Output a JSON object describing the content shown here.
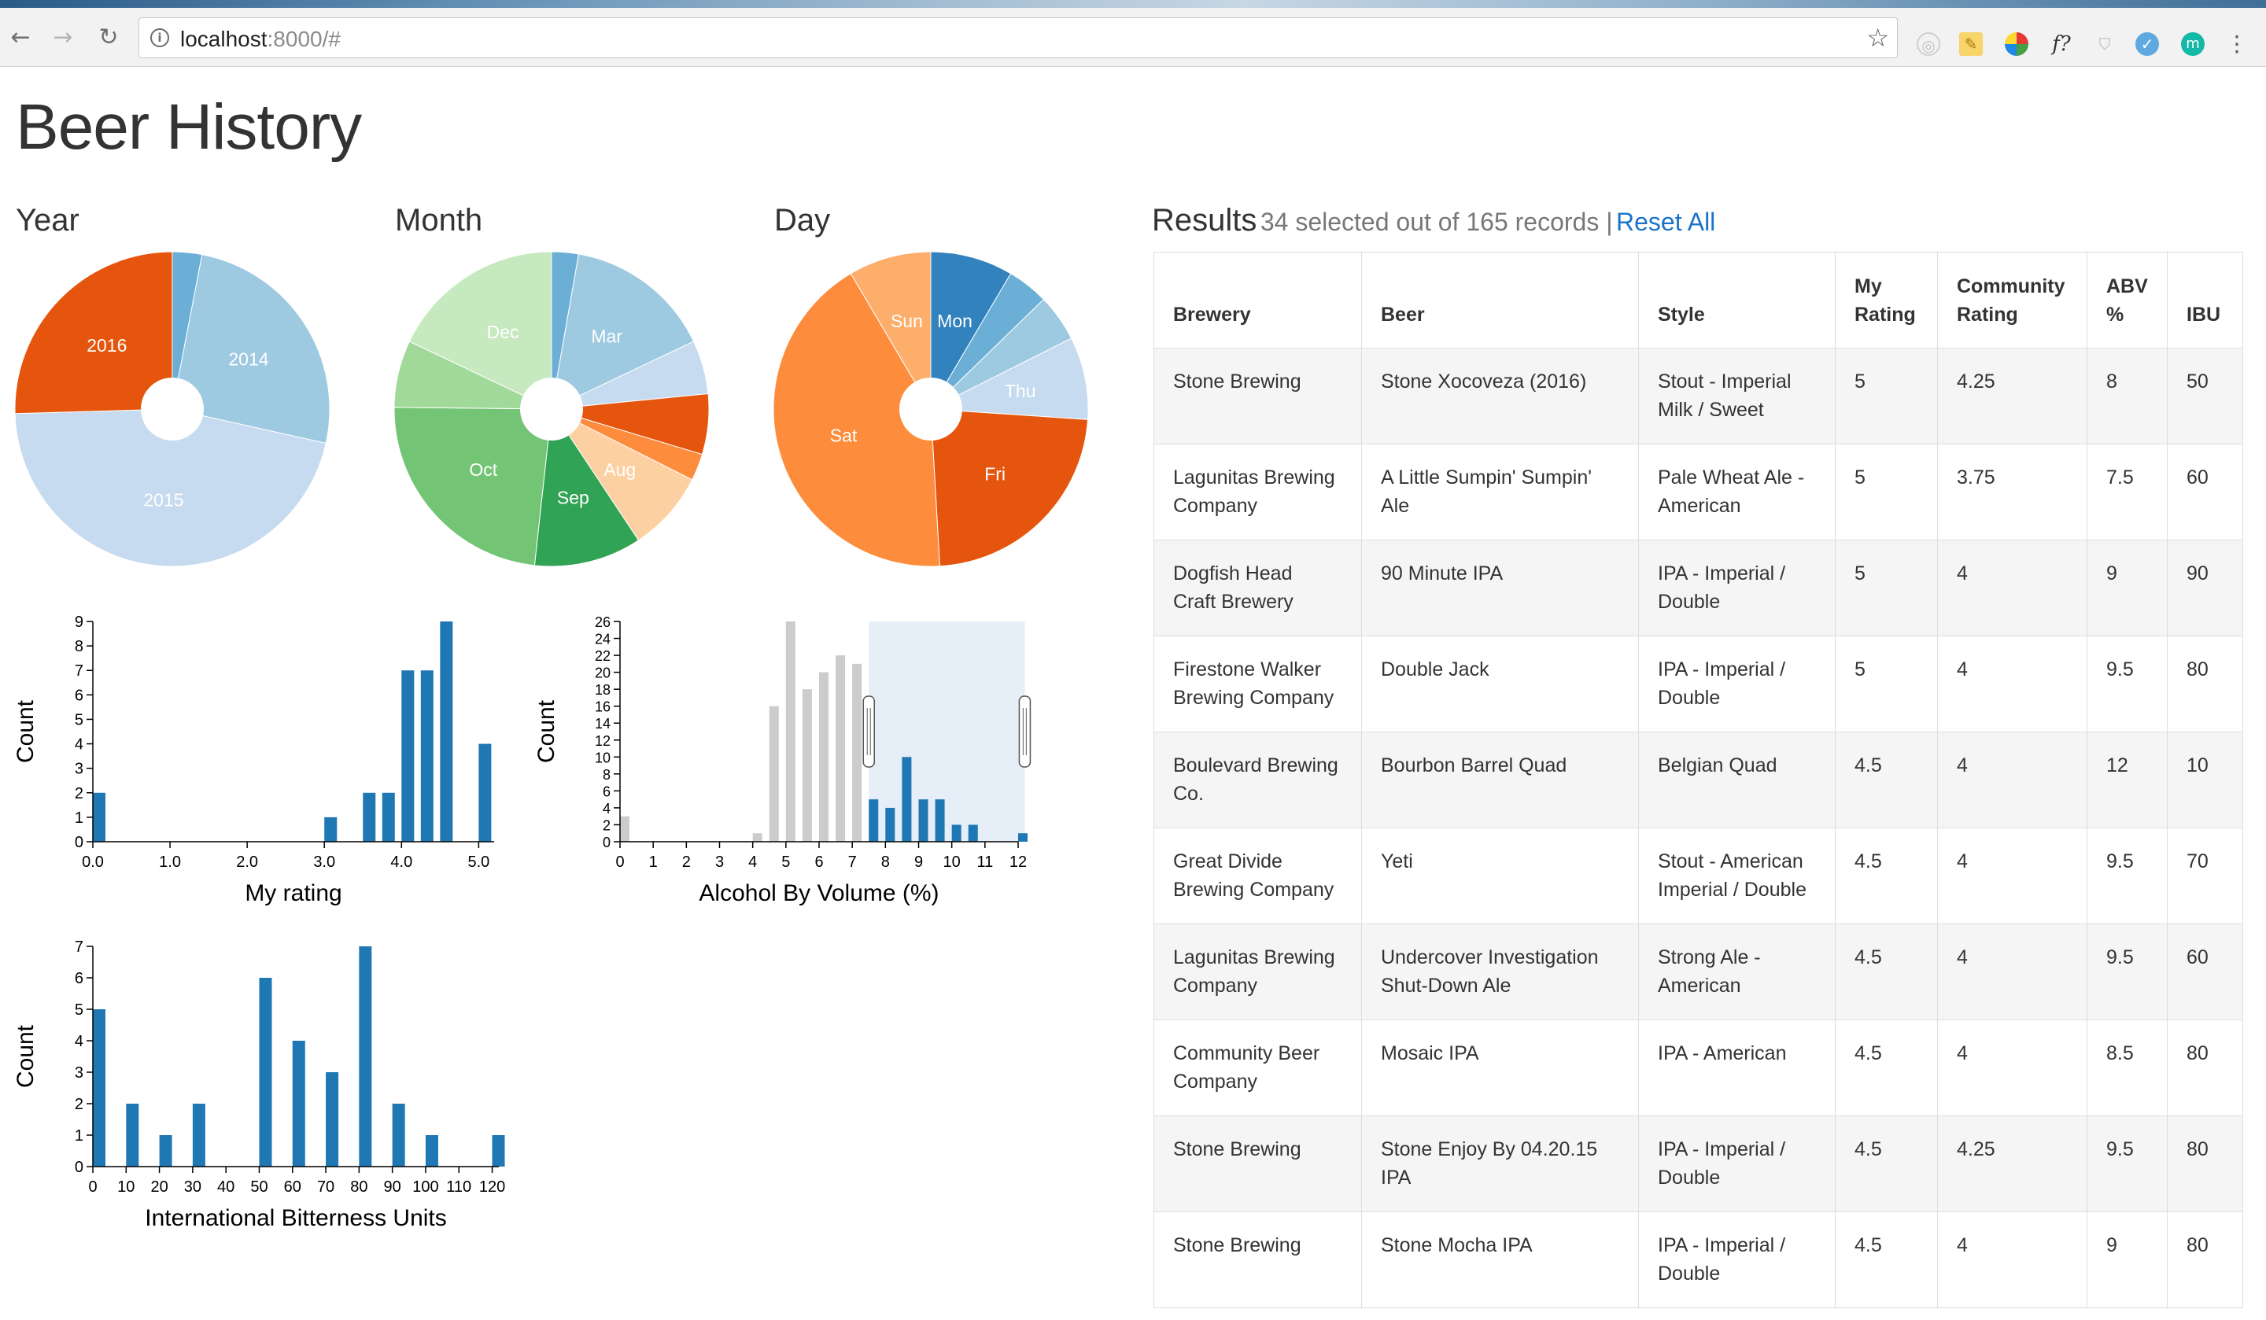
{
  "browser": {
    "url_host": "localhost",
    "url_rest": ":8000/#"
  },
  "page": {
    "title": "Beer History"
  },
  "pies": {
    "year": {
      "title": "Year",
      "slices": [
        {
          "label": "",
          "value": 5,
          "color": "#6baed6"
        },
        {
          "label": "2014",
          "value": 42,
          "color": "#9ecae1"
        },
        {
          "label": "2015",
          "value": 76,
          "color": "#c6dbef"
        },
        {
          "label": "2016",
          "value": 42,
          "color": "#e6550d"
        }
      ]
    },
    "month": {
      "title": "Month",
      "slices": [
        {
          "label": "",
          "value": 4,
          "color": "#6baed6"
        },
        {
          "label": "Mar",
          "value": 22,
          "color": "#9ecae1"
        },
        {
          "label": "",
          "value": 8,
          "color": "#c6dbef"
        },
        {
          "label": "",
          "value": 9,
          "color": "#e6550d"
        },
        {
          "label": "",
          "value": 4,
          "color": "#fd8d3c"
        },
        {
          "label": "Aug",
          "value": 12,
          "color": "#fdd0a2"
        },
        {
          "label": "Sep",
          "value": 16,
          "color": "#31a354"
        },
        {
          "label": "Oct",
          "value": 34,
          "color": "#74c476"
        },
        {
          "label": "",
          "value": 10,
          "color": "#a1d99b"
        },
        {
          "label": "Dec",
          "value": 26,
          "color": "#c7e9c0"
        }
      ]
    },
    "day": {
      "title": "Day",
      "slices": [
        {
          "label": "Mon",
          "value": 14,
          "color": "#3182bd"
        },
        {
          "label": "",
          "value": 7,
          "color": "#6baed6"
        },
        {
          "label": "",
          "value": 8,
          "color": "#9ecae1"
        },
        {
          "label": "Thu",
          "value": 14,
          "color": "#c6dbef"
        },
        {
          "label": "Fri",
          "value": 38,
          "color": "#e6550d"
        },
        {
          "label": "Sat",
          "value": 70,
          "color": "#fd8d3c"
        },
        {
          "label": "Sun",
          "value": 14,
          "color": "#fdae6b"
        }
      ]
    }
  },
  "histograms": {
    "rating": {
      "xlabel": "My rating",
      "ylabel": "Count",
      "ylim": [
        0,
        9
      ],
      "yticks": [
        "0",
        "1",
        "2",
        "3",
        "4",
        "5",
        "6",
        "7",
        "8",
        "9"
      ],
      "xlim": [
        0,
        5.2
      ],
      "xticks": [
        {
          "v": 0,
          "t": "0.0"
        },
        {
          "v": 1,
          "t": "1.0"
        },
        {
          "v": 2,
          "t": "2.0"
        },
        {
          "v": 3,
          "t": "3.0"
        },
        {
          "v": 4,
          "t": "4.0"
        },
        {
          "v": 5,
          "t": "5.0"
        }
      ],
      "bars": [
        {
          "x": 0.0,
          "y": 2
        },
        {
          "x": 3.0,
          "y": 1
        },
        {
          "x": 3.5,
          "y": 2
        },
        {
          "x": 3.75,
          "y": 2
        },
        {
          "x": 4.0,
          "y": 7
        },
        {
          "x": 4.25,
          "y": 7
        },
        {
          "x": 4.5,
          "y": 9
        },
        {
          "x": 5.0,
          "y": 4
        }
      ]
    },
    "abv": {
      "xlabel": "Alcohol By Volume (%)",
      "ylabel": "Count",
      "ylim": [
        0,
        26
      ],
      "yticks": [
        "0",
        "2",
        "4",
        "6",
        "8",
        "10",
        "12",
        "14",
        "16",
        "18",
        "20",
        "22",
        "24",
        "26"
      ],
      "xlim": [
        0,
        12
      ],
      "xticks": [
        {
          "v": 0,
          "t": "0"
        },
        {
          "v": 1,
          "t": "1"
        },
        {
          "v": 2,
          "t": "2"
        },
        {
          "v": 3,
          "t": "3"
        },
        {
          "v": 4,
          "t": "4"
        },
        {
          "v": 5,
          "t": "5"
        },
        {
          "v": 6,
          "t": "6"
        },
        {
          "v": 7,
          "t": "7"
        },
        {
          "v": 8,
          "t": "8"
        },
        {
          "v": 9,
          "t": "9"
        },
        {
          "v": 10,
          "t": "10"
        },
        {
          "v": 11,
          "t": "11"
        },
        {
          "v": 12,
          "t": "12"
        }
      ],
      "brush": [
        7.5,
        12.2
      ],
      "bars": [
        {
          "x": 0.0,
          "y": 3,
          "sel": false
        },
        {
          "x": 4.0,
          "y": 1,
          "sel": false
        },
        {
          "x": 4.5,
          "y": 16,
          "sel": false
        },
        {
          "x": 5.0,
          "y": 26,
          "sel": false
        },
        {
          "x": 5.5,
          "y": 18,
          "sel": false
        },
        {
          "x": 6.0,
          "y": 20,
          "sel": false
        },
        {
          "x": 6.5,
          "y": 22,
          "sel": false
        },
        {
          "x": 7.0,
          "y": 21,
          "sel": false
        },
        {
          "x": 7.5,
          "y": 5,
          "sel": true
        },
        {
          "x": 8.0,
          "y": 4,
          "sel": true
        },
        {
          "x": 8.5,
          "y": 10,
          "sel": true
        },
        {
          "x": 9.0,
          "y": 5,
          "sel": true
        },
        {
          "x": 9.5,
          "y": 5,
          "sel": true
        },
        {
          "x": 10.0,
          "y": 2,
          "sel": true
        },
        {
          "x": 10.5,
          "y": 2,
          "sel": true
        },
        {
          "x": 12.0,
          "y": 1,
          "sel": true
        }
      ]
    },
    "ibu": {
      "xlabel": "International Bitterness Units",
      "ylabel": "Count",
      "ylim": [
        0,
        7
      ],
      "yticks": [
        "0",
        "1",
        "2",
        "3",
        "4",
        "5",
        "6",
        "7"
      ],
      "xlim": [
        0,
        122
      ],
      "xticks": [
        {
          "v": 0,
          "t": "0"
        },
        {
          "v": 10,
          "t": "10"
        },
        {
          "v": 20,
          "t": "20"
        },
        {
          "v": 30,
          "t": "30"
        },
        {
          "v": 40,
          "t": "40"
        },
        {
          "v": 50,
          "t": "50"
        },
        {
          "v": 60,
          "t": "60"
        },
        {
          "v": 70,
          "t": "70"
        },
        {
          "v": 80,
          "t": "80"
        },
        {
          "v": 90,
          "t": "90"
        },
        {
          "v": 100,
          "t": "100"
        },
        {
          "v": 110,
          "t": "110"
        },
        {
          "v": 120,
          "t": "120"
        }
      ],
      "bars": [
        {
          "x": 0,
          "y": 5
        },
        {
          "x": 10,
          "y": 2
        },
        {
          "x": 20,
          "y": 1
        },
        {
          "x": 30,
          "y": 2
        },
        {
          "x": 50,
          "y": 6
        },
        {
          "x": 60,
          "y": 4
        },
        {
          "x": 70,
          "y": 3
        },
        {
          "x": 80,
          "y": 7
        },
        {
          "x": 90,
          "y": 2
        },
        {
          "x": 100,
          "y": 1
        },
        {
          "x": 120,
          "y": 1
        }
      ]
    }
  },
  "results": {
    "title": "Results",
    "summary": "34 selected out of 165 records |",
    "reset_label": "Reset All",
    "columns": [
      {
        "l1": "Brewery",
        "l2": ""
      },
      {
        "l1": "Beer",
        "l2": ""
      },
      {
        "l1": "Style",
        "l2": ""
      },
      {
        "l1": "My",
        "l2": "Rating"
      },
      {
        "l1": "Community",
        "l2": "Rating"
      },
      {
        "l1": "ABV",
        "l2": "%"
      },
      {
        "l1": "IBU",
        "l2": ""
      }
    ],
    "rows": [
      {
        "brewery": [
          "Stone Brewing",
          ""
        ],
        "beer": [
          "Stone Xocoveza (2016)",
          ""
        ],
        "style": [
          "Stout - Imperial",
          "Milk / Sweet"
        ],
        "my": "5",
        "community": "4.25",
        "abv": "8",
        "ibu": "50"
      },
      {
        "brewery": [
          "Lagunitas Brewing",
          "Company"
        ],
        "beer": [
          "A Little Sumpin' Sumpin'",
          "Ale"
        ],
        "style": [
          "Pale Wheat Ale -",
          "American"
        ],
        "my": "5",
        "community": "3.75",
        "abv": "7.5",
        "ibu": "60"
      },
      {
        "brewery": [
          "Dogfish Head",
          "Craft Brewery"
        ],
        "beer": [
          "90 Minute IPA",
          ""
        ],
        "style": [
          "IPA - Imperial /",
          "Double"
        ],
        "my": "5",
        "community": "4",
        "abv": "9",
        "ibu": "90"
      },
      {
        "brewery": [
          "Firestone Walker",
          "Brewing Company"
        ],
        "beer": [
          "Double Jack",
          ""
        ],
        "style": [
          "IPA - Imperial /",
          "Double"
        ],
        "my": "5",
        "community": "4",
        "abv": "9.5",
        "ibu": "80"
      },
      {
        "brewery": [
          "Boulevard Brewing",
          "Co."
        ],
        "beer": [
          "Bourbon Barrel Quad",
          ""
        ],
        "style": [
          "Belgian Quad",
          ""
        ],
        "my": "4.5",
        "community": "4",
        "abv": "12",
        "ibu": "10"
      },
      {
        "brewery": [
          "Great Divide",
          "Brewing Company"
        ],
        "beer": [
          "Yeti",
          ""
        ],
        "style": [
          "Stout - American",
          "Imperial / Double"
        ],
        "my": "4.5",
        "community": "4",
        "abv": "9.5",
        "ibu": "70"
      },
      {
        "brewery": [
          "Lagunitas Brewing",
          "Company"
        ],
        "beer": [
          "Undercover Investigation",
          "Shut-Down Ale"
        ],
        "style": [
          "Strong Ale -",
          "American"
        ],
        "my": "4.5",
        "community": "4",
        "abv": "9.5",
        "ibu": "60"
      },
      {
        "brewery": [
          "Community Beer",
          "Company"
        ],
        "beer": [
          "Mosaic IPA",
          ""
        ],
        "style": [
          "IPA - American",
          ""
        ],
        "my": "4.5",
        "community": "4",
        "abv": "8.5",
        "ibu": "80"
      },
      {
        "brewery": [
          "Stone Brewing",
          ""
        ],
        "beer": [
          "Stone Enjoy By 04.20.15",
          "IPA"
        ],
        "style": [
          "IPA - Imperial /",
          "Double"
        ],
        "my": "4.5",
        "community": "4.25",
        "abv": "9.5",
        "ibu": "80"
      },
      {
        "brewery": [
          "Stone Brewing",
          ""
        ],
        "beer": [
          "Stone Mocha IPA",
          ""
        ],
        "style": [
          "IPA - Imperial /",
          "Double"
        ],
        "my": "4.5",
        "community": "4",
        "abv": "9",
        "ibu": "80"
      }
    ]
  },
  "chart_data": [
    {
      "type": "pie",
      "title": "Year",
      "categories": [
        "",
        "2014",
        "2015",
        "2016"
      ],
      "values": [
        5,
        42,
        76,
        42
      ]
    },
    {
      "type": "pie",
      "title": "Month",
      "categories": [
        "",
        "Mar",
        "",
        "",
        "",
        "Aug",
        "Sep",
        "Oct",
        "",
        "Dec"
      ],
      "values": [
        4,
        22,
        8,
        9,
        4,
        12,
        16,
        34,
        10,
        26
      ]
    },
    {
      "type": "pie",
      "title": "Day",
      "categories": [
        "Mon",
        "",
        "",
        "Thu",
        "Fri",
        "Sat",
        "Sun"
      ],
      "values": [
        14,
        7,
        8,
        14,
        38,
        70,
        14
      ]
    },
    {
      "type": "bar",
      "xlabel": "My rating",
      "ylabel": "Count",
      "x": [
        0.0,
        3.0,
        3.5,
        3.75,
        4.0,
        4.25,
        4.5,
        5.0
      ],
      "values": [
        2,
        1,
        2,
        2,
        7,
        7,
        9,
        4
      ],
      "ylim": [
        0,
        9
      ]
    },
    {
      "type": "bar",
      "xlabel": "Alcohol By Volume (%)",
      "ylabel": "Count",
      "x": [
        0,
        4,
        4.5,
        5,
        5.5,
        6,
        6.5,
        7,
        7.5,
        8,
        8.5,
        9,
        9.5,
        10,
        10.5,
        12
      ],
      "values": [
        3,
        1,
        16,
        26,
        18,
        20,
        22,
        21,
        5,
        4,
        10,
        5,
        5,
        2,
        2,
        1
      ],
      "ylim": [
        0,
        26
      ]
    },
    {
      "type": "bar",
      "xlabel": "International Bitterness Units",
      "ylabel": "Count",
      "x": [
        0,
        10,
        20,
        30,
        50,
        60,
        70,
        80,
        90,
        100,
        120
      ],
      "values": [
        5,
        2,
        1,
        2,
        6,
        4,
        3,
        7,
        2,
        1,
        1
      ],
      "ylim": [
        0,
        7
      ]
    }
  ]
}
